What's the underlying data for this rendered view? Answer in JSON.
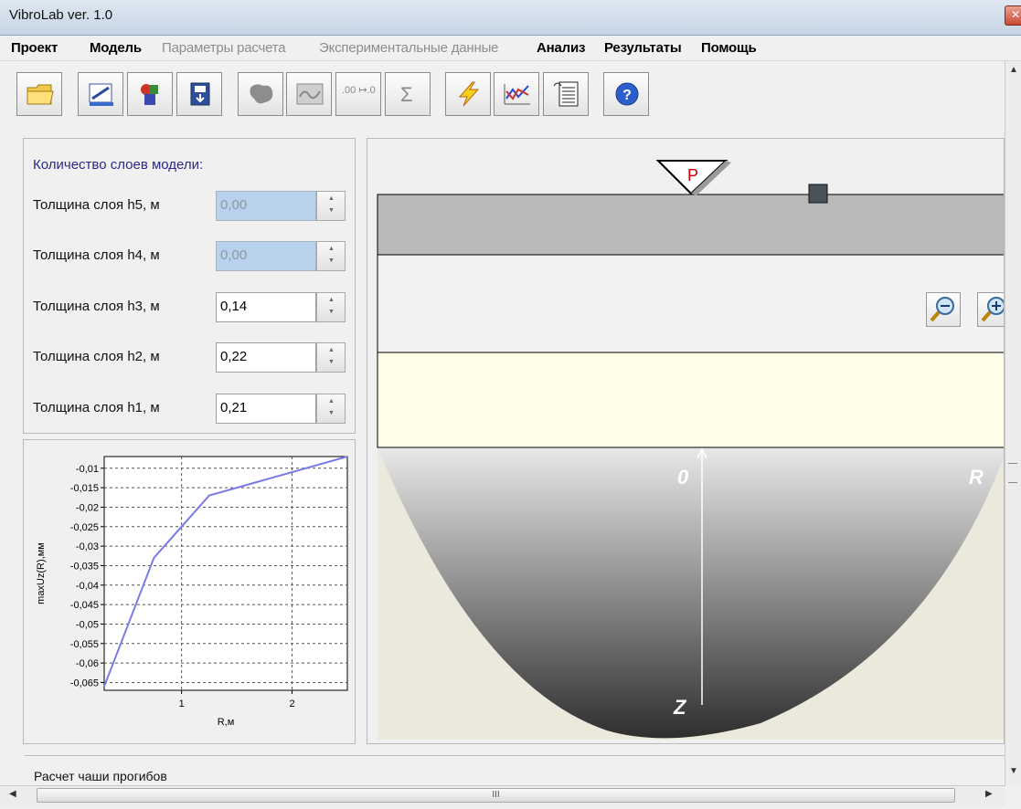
{
  "window": {
    "title": "VibroLab ver. 1.0",
    "close_glyph": "✕"
  },
  "menu": [
    "Проект",
    "Модель",
    "Параметры расчета",
    "Экспериментальные данные",
    "Анализ",
    "Результаты",
    "Помощь"
  ],
  "toolbar": {
    "icons": [
      "open-folder-icon",
      "edit-model-icon",
      "layers-icon",
      "save-icon",
      "shape-icon",
      "wave-icon",
      "decimal-icon",
      "sigma-icon",
      "lightning-icon",
      "chart-icon",
      "report-icon",
      "help-icon"
    ],
    "decimal_glyph": ".00 ↦.0",
    "sigma_glyph": "Σ",
    "help_glyph": "?"
  },
  "params": {
    "count_label": "Количество слоев модели:",
    "rows": [
      {
        "label": "Толщина слоя h5, м",
        "value": "0,00",
        "disabled": true
      },
      {
        "label": "Толщина слоя h4, м",
        "value": "0,00",
        "disabled": true
      },
      {
        "label": "Толщина слоя h3, м",
        "value": "0,14",
        "disabled": false
      },
      {
        "label": "Толщина слоя h2, м",
        "value": "0,22",
        "disabled": false
      },
      {
        "label": "Толщина слоя h1, м",
        "value": "0,21",
        "disabled": false
      }
    ]
  },
  "chart_data": {
    "type": "line",
    "x": [
      0.3,
      0.75,
      1.25,
      2.5
    ],
    "y": [
      -0.066,
      -0.033,
      -0.017,
      -0.007
    ],
    "xlabel": "R,м",
    "ylabel": "maxUz(R),мм",
    "xlim": [
      0.3,
      2.5
    ],
    "ylim": [
      -0.067,
      -0.007
    ],
    "xticks": [
      1,
      2
    ],
    "yticks": [
      -0.01,
      -0.015,
      -0.02,
      -0.025,
      -0.03,
      -0.035,
      -0.04,
      -0.045,
      -0.05,
      -0.055,
      -0.06,
      -0.065
    ],
    "ytick_labels": [
      "-0,01",
      "-0,015",
      "-0,02",
      "-0,025",
      "-0,03",
      "-0,035",
      "-0,04",
      "-0,045",
      "-0,05",
      "-0,055",
      "-0,06",
      "-0,065"
    ],
    "grid": true,
    "line_color": "#7b7be8"
  },
  "diagram": {
    "load_label": "P",
    "origin_label": "0",
    "r_label": "R",
    "z_label": "Z"
  },
  "colors": {
    "layer_top": "#b9b9b9",
    "layer_middle": "#f2f2f2",
    "layer_bottom": "#fdfde8",
    "bowl_dark": "#2e2e2e",
    "load_text": "#d40000"
  },
  "status_text": "Расчет чаши прогибов",
  "hscroll_thumb": "III"
}
